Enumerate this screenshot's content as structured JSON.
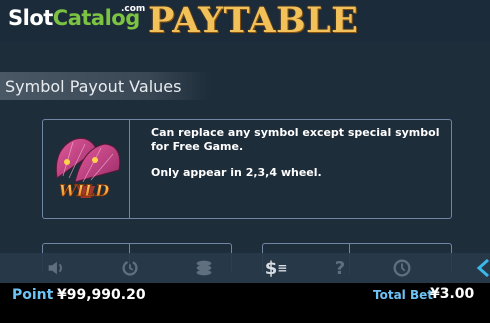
{
  "watermark": {
    "slot": "Slot",
    "catalog": "Catalog",
    "com": ".com"
  },
  "header": {
    "title": "PAYTABLE"
  },
  "section": {
    "title": "Symbol Payout Values"
  },
  "wild_card": {
    "symbol_label": "WILD",
    "line1": "Can replace any symbol except special symbol for Free Game.",
    "line2": "Only appear in 2,3,4 wheel."
  },
  "toolbar": {
    "buttons": [
      "sound-icon",
      "autoplay-icon",
      "bet-coins-icon",
      "paytable-icon",
      "help-icon",
      "history-icon",
      "spin-icon"
    ],
    "paytable_glyph": "$",
    "help_glyph": "?"
  },
  "status": {
    "point_label": "Point",
    "point_value": "¥99,990.20",
    "total_bet_label": "Total Bet",
    "total_bet_value": "¥3.00"
  },
  "colors": {
    "title_gold": "#f2c15a",
    "status_label": "#6ec3f5",
    "card_border": "#6f85a4",
    "background": "#1e2d3a"
  }
}
